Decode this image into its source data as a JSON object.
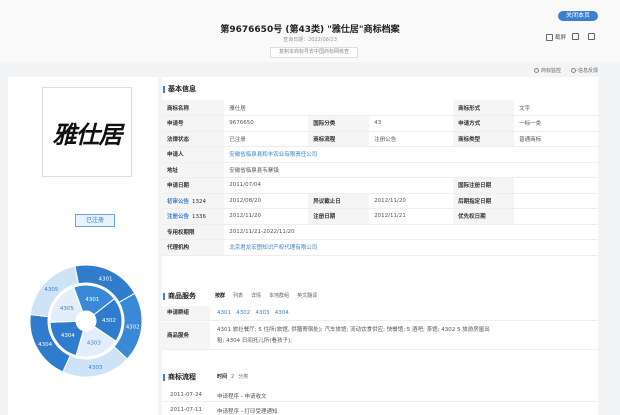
{
  "header": {
    "close_label": "关闭本页",
    "title": "第9676650号 (第43类) \"雅仕居\"商标档案",
    "query_date": "查询日期：2022/08/23",
    "copy_label": "复制本商标号去中国商标网核查",
    "tools": [
      "截屏",
      "",
      ""
    ]
  },
  "sub_toolbar": [
    "商标监控",
    "信息反馈"
  ],
  "left": {
    "logo_text": "雅仕居",
    "status": "已注册",
    "donut_outer": [
      "4301",
      "4302",
      "4303",
      "4304",
      "4305"
    ],
    "donut_inner": [
      "4301",
      "4302",
      "4303",
      "4304",
      "4305"
    ]
  },
  "basic": {
    "section_title": "基本信息",
    "rows": [
      {
        "l1": "商标名称",
        "v1": "雅仕居",
        "l2": "",
        "v2": "",
        "l3": "商标形式",
        "v3": "文字"
      },
      {
        "l1": "申请号",
        "v1": "9676650",
        "l2": "国际分类",
        "v2": "43",
        "l3": "申请方式",
        "v3": "一标一类"
      },
      {
        "l1": "法律状态",
        "v1": "已注册",
        "l2": "商标流程",
        "v2": "注册公告",
        "l3": "商标类型",
        "v3": "普通商标"
      },
      {
        "l1": "申请人",
        "v1": "安徽省临泉县和丰农业有限责任公司",
        "l2": "",
        "v2": "",
        "l3": "",
        "v3": ""
      },
      {
        "l1": "地址",
        "v1": "安徽省临泉县韦寨镇",
        "l2": "",
        "v2": "",
        "l3": "",
        "v3": ""
      },
      {
        "l1": "申请日期",
        "v1": "2011/07/04",
        "l2": "",
        "v2": "",
        "l3": "国际注册日期",
        "v3": ""
      },
      {
        "l1": "初审公告",
        "l1b": "1324",
        "v1": "2012/08/20",
        "l2": "异议截止日",
        "v2": "2012/11/20",
        "l3": "后期指定日期",
        "v3": ""
      },
      {
        "l1": "注册公告",
        "l1b": "1336",
        "v1": "2012/11/20",
        "l2": "注册日期",
        "v2": "2012/11/21",
        "l3": "优先权日期",
        "v3": ""
      },
      {
        "l1": "专用权期限",
        "v1": "2012/11/21-2022/11/20",
        "l2": "",
        "v2": "",
        "l3": "",
        "v3": ""
      },
      {
        "l1": "代理机构",
        "v1": "北京君龙宏图知识产权代理有限公司",
        "l2": "",
        "v2": "",
        "l3": "",
        "v3": ""
      }
    ]
  },
  "services": {
    "section_title": "商品服务",
    "tabs": [
      "按群",
      "列表",
      "详情",
      "本地群组",
      "英文翻译"
    ],
    "groups_label": "申请群组",
    "groups": [
      "4301",
      "4302",
      "4303",
      "4304"
    ],
    "items_label": "商品服务",
    "items_line1": "4301  旅社餐厅;  5  住所(旅馆, 供膳寄宿处);  汽车旅馆;  流动饮食供应;  快餐馆;  5  酒吧;  茶馆;  4302  5  旅游房屋出",
    "items_line2": "租;  4304  日间托儿所(看孩子);"
  },
  "flow": {
    "section_title": "商标流程",
    "tabs": [
      "时间",
      "2",
      "分类"
    ],
    "rows": [
      {
        "date": "2011-07-24",
        "text": "申请程序 - 申请收文"
      },
      {
        "date": "2011-07-11",
        "text": "申请程序 - 打印受理通知"
      }
    ]
  }
}
